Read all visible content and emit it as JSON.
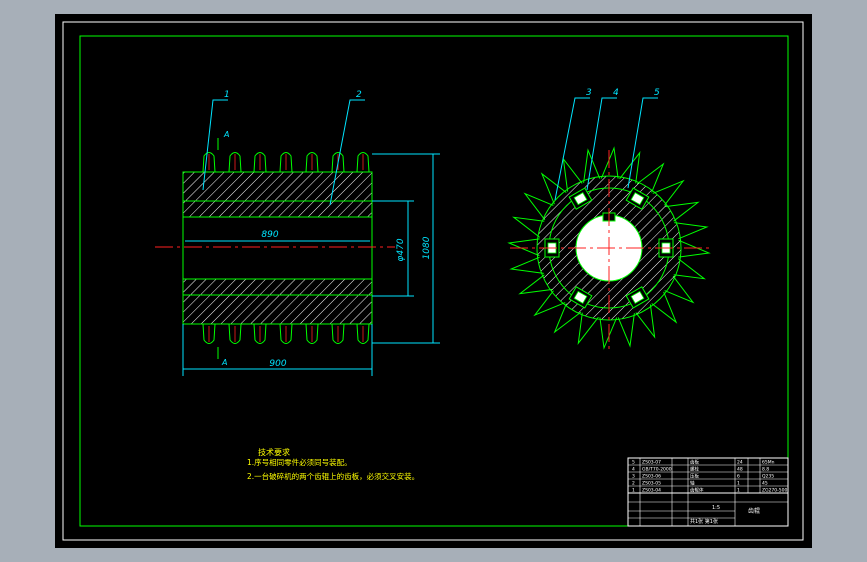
{
  "drawing": {
    "colors": {
      "background": "#000000",
      "frame": "#ffffff",
      "border": "#00ff00",
      "outline": "#00ff00",
      "dimension": "#00e5ff",
      "centerline": "#ff2020",
      "hatch": "#ffffff",
      "leader": "#00e5ff",
      "note_text": "#ffff00",
      "title_text": "#ffffff",
      "window_bg": "#a7afb8"
    },
    "front_view": {
      "part_labels": [
        "1",
        "2"
      ],
      "section_marks": [
        "A",
        "A"
      ],
      "dimensions": {
        "inner_length": "890",
        "overall_length": "900",
        "bore_diameter": "φ470",
        "outer_diameter": "1080"
      }
    },
    "side_view": {
      "part_labels": [
        "3",
        "4",
        "5"
      ],
      "tooth_count": 24,
      "block_count": 6
    },
    "notes": {
      "heading": "技术要求",
      "lines": [
        "1.序号相同零件必须同号装配。",
        "2.一台破碎机的两个齿辊上的齿板，必须交叉安装。"
      ]
    },
    "title_block": {
      "bom_rows": [
        {
          "no": "5",
          "code": "ZS03-07",
          "name": "齿板",
          "qty": "24",
          "material": "65Mn"
        },
        {
          "no": "4",
          "code": "GB/T70-2000",
          "name": "螺栓",
          "qty": "48",
          "material": "8.8"
        },
        {
          "no": "3",
          "code": "ZS03-06",
          "name": "压板",
          "qty": "6",
          "material": "Q235"
        },
        {
          "no": "2",
          "code": "ZS03-05",
          "name": "轴",
          "qty": "1",
          "material": "45"
        },
        {
          "no": "1",
          "code": "ZS03-04",
          "name": "齿辊体",
          "qty": "1",
          "material": "ZG270-500"
        }
      ],
      "title": "齿辊",
      "scale": "1:5",
      "sheet": "共1张 第1张"
    }
  }
}
